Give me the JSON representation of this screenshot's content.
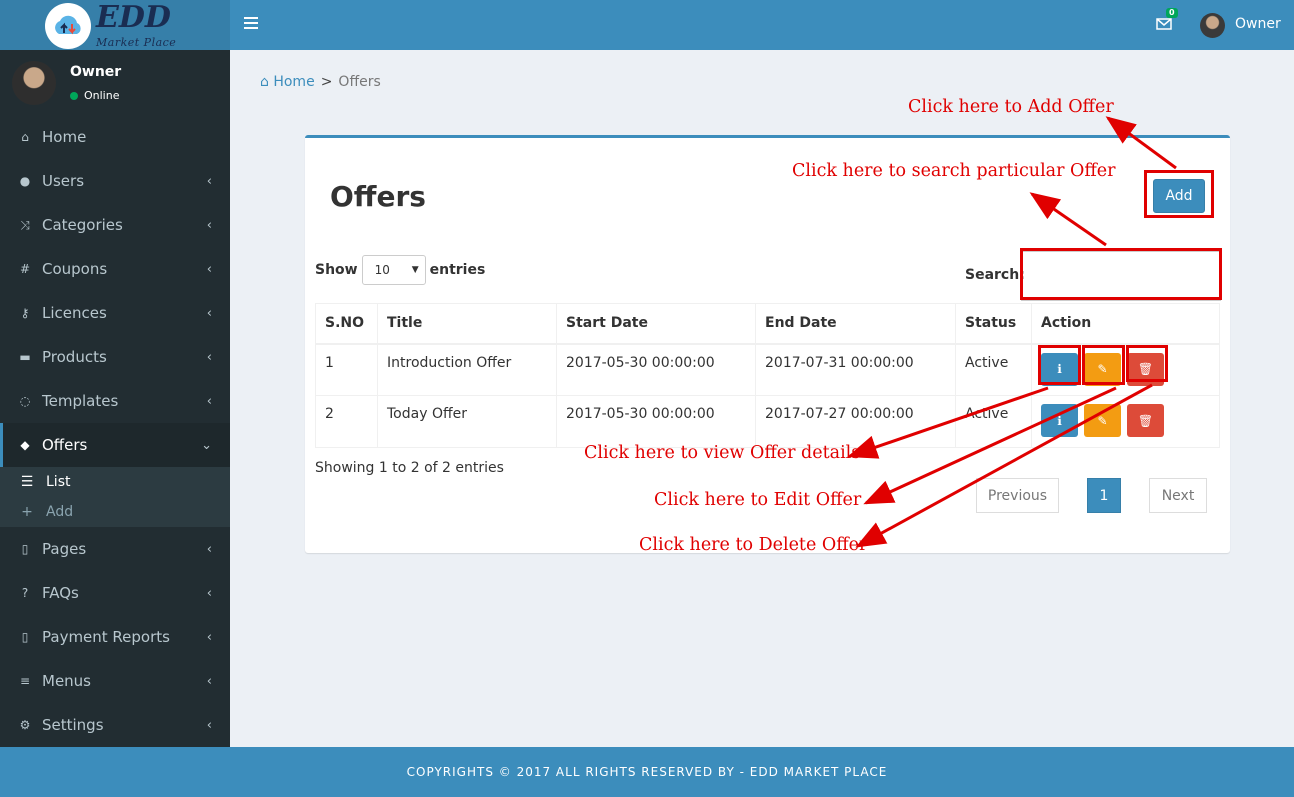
{
  "brand": {
    "name": "EDD",
    "tagline": "Market Place"
  },
  "header": {
    "mail_count": "0",
    "user_name": "Owner"
  },
  "sidebar": {
    "user": {
      "name": "Owner",
      "status": "Online"
    },
    "items": [
      {
        "label": "Home",
        "icon": "home-icon"
      },
      {
        "label": "Users",
        "icon": "users-icon"
      },
      {
        "label": "Categories",
        "icon": "random-icon"
      },
      {
        "label": "Coupons",
        "icon": "hash-icon"
      },
      {
        "label": "Licences",
        "icon": "key-icon"
      },
      {
        "label": "Products",
        "icon": "briefcase-icon"
      },
      {
        "label": "Templates",
        "icon": "comment-icon"
      },
      {
        "label": "Offers",
        "icon": "tags-icon"
      },
      {
        "label": "Pages",
        "icon": "file-icon"
      },
      {
        "label": "FAQs",
        "icon": "question-icon"
      },
      {
        "label": "Payment Reports",
        "icon": "file-icon"
      },
      {
        "label": "Menus",
        "icon": "bars-icon"
      },
      {
        "label": "Settings",
        "icon": "gear-icon"
      }
    ],
    "offers_sub": [
      {
        "label": "List"
      },
      {
        "label": "Add"
      }
    ]
  },
  "breadcrumb": {
    "home": "Home",
    "separator": ">",
    "current": "Offers"
  },
  "main": {
    "title": "Offers",
    "add_label": "Add",
    "show_label": "Show",
    "entries_label": "entries",
    "page_size": "10",
    "search_label": "Search:",
    "columns": [
      "S.NO",
      "Title",
      "Start Date",
      "End Date",
      "Status",
      "Action"
    ],
    "rows": [
      {
        "sno": "1",
        "title": "Introduction Offer",
        "start": "2017-05-30 00:00:00",
        "end": "2017-07-31 00:00:00",
        "status": "Active"
      },
      {
        "sno": "2",
        "title": "Today Offer",
        "start": "2017-05-30 00:00:00",
        "end": "2017-07-27 00:00:00",
        "status": "Active"
      }
    ],
    "showing": "Showing 1 to 2 of 2 entries",
    "pagination": {
      "previous": "Previous",
      "current": "1",
      "next": "Next"
    }
  },
  "annotations": {
    "add": "Click here to Add Offer",
    "search": "Click here to search particular Offer",
    "view": "Click here to view Offer details",
    "edit": "Click here to Edit Offer",
    "delete": "Click here to Delete Offer"
  },
  "footer": {
    "text": "COPYRIGHTS © 2017 ALL RIGHTS RESERVED BY - EDD MARKET PLACE"
  },
  "colors": {
    "header": "#3c8dbc",
    "sidebar": "#222d32",
    "annotation": "#e00000",
    "edit": "#f39c12",
    "delete": "#dd4b39"
  }
}
